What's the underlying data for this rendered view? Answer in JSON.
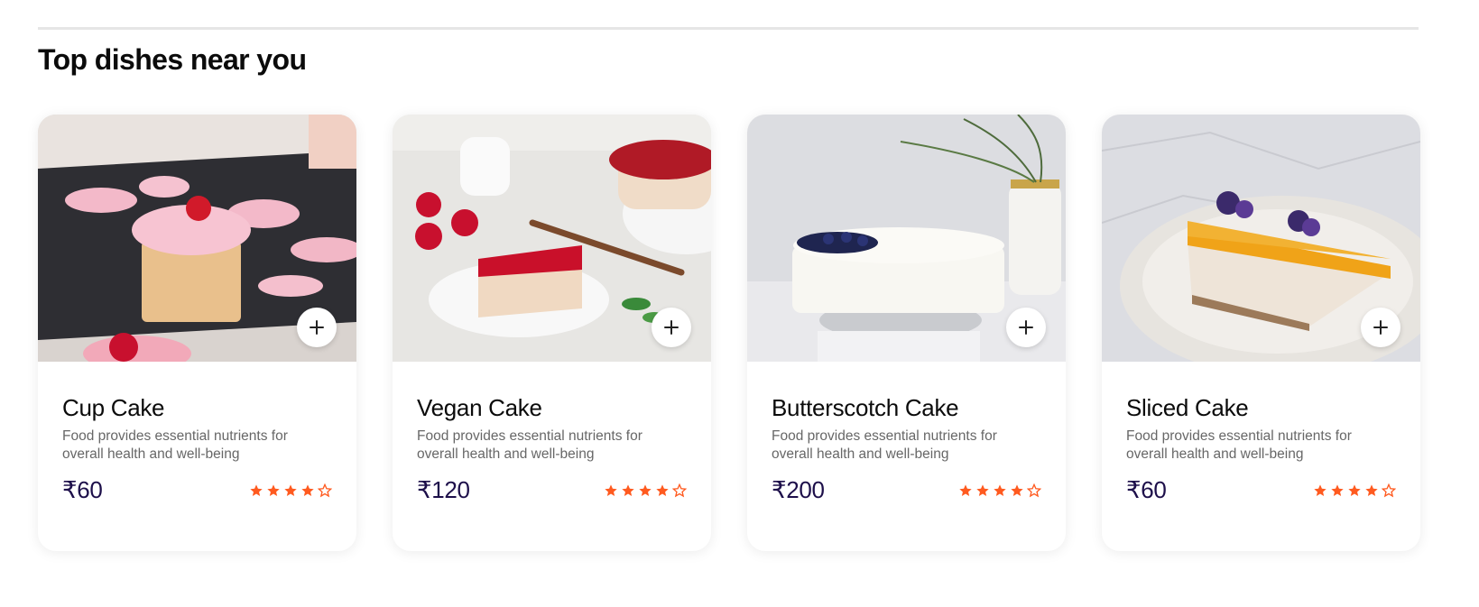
{
  "section": {
    "title": "Top dishes near you"
  },
  "colors": {
    "accent": "#ff5a1f",
    "price": "#1d0f4a",
    "description": "#676767"
  },
  "dishes": [
    {
      "name": "Cup Cake",
      "description": "Food provides essential nutrients for overall health and well-being",
      "price": "₹60",
      "rating": 4,
      "rating_max": 5,
      "add_icon": "plus-icon"
    },
    {
      "name": "Vegan Cake",
      "description": "Food provides essential nutrients for overall health and well-being",
      "price": "₹120",
      "rating": 4,
      "rating_max": 5,
      "add_icon": "plus-icon"
    },
    {
      "name": "Butterscotch Cake",
      "description": "Food provides essential nutrients for overall health and well-being",
      "price": "₹200",
      "rating": 4,
      "rating_max": 5,
      "add_icon": "plus-icon"
    },
    {
      "name": "Sliced Cake",
      "description": "Food provides essential nutrients for overall health and well-being",
      "price": "₹60",
      "rating": 4,
      "rating_max": 5,
      "add_icon": "plus-icon"
    }
  ]
}
